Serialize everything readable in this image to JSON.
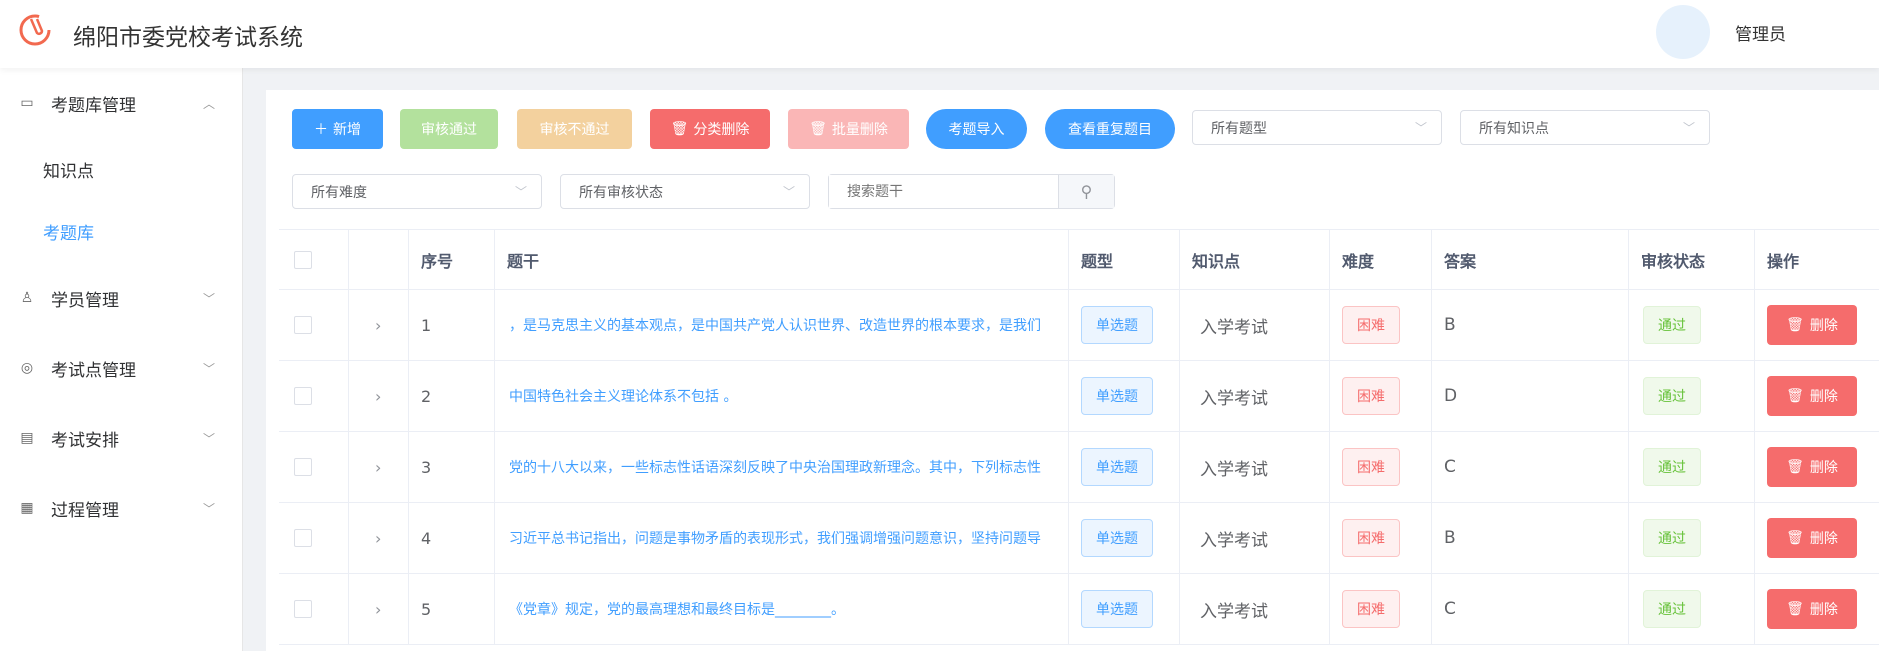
{
  "header": {
    "title": "绵阳市委党校考试系统",
    "user": "管理员"
  },
  "sidebar": {
    "groups": [
      {
        "label": "考题库管理",
        "icon": "folder-icon",
        "expanded": true,
        "children": [
          "知识点",
          "考题库"
        ]
      },
      {
        "label": "学员管理",
        "icon": "user-icon"
      },
      {
        "label": "考试点管理",
        "icon": "location-icon"
      },
      {
        "label": "考试安排",
        "icon": "calendar-icon"
      },
      {
        "label": "过程管理",
        "icon": "grid-icon"
      }
    ],
    "active": "考题库"
  },
  "toolbar": {
    "add": "新增",
    "approve": "审核通过",
    "reject": "审核不通过",
    "delete_category": "分类删除",
    "batch_delete": "批量删除",
    "import": "考题导入",
    "duplicates": "查看重复题目",
    "type_select": "所有题型",
    "knowledge_select": "所有知识点",
    "difficulty_select": "所有难度",
    "status_select": "所有审核状态",
    "search_placeholder": "搜索题干"
  },
  "table": {
    "headers": [
      "序号",
      "题干",
      "题型",
      "知识点",
      "难度",
      "答案",
      "审核状态",
      "操作"
    ],
    "rows": [
      {
        "no": "1",
        "stem": "，是马克思主义的基本观点，是中国共产党人认识世界、改造世界的根本要求，是我们",
        "type": "单选题",
        "knowledge": "入学考试",
        "difficulty": "困难",
        "answer": "B",
        "status": "通过",
        "action": "删除"
      },
      {
        "no": "2",
        "stem": "中国特色社会主义理论体系不包括 。",
        "type": "单选题",
        "knowledge": "入学考试",
        "difficulty": "困难",
        "answer": "D",
        "status": "通过",
        "action": "删除"
      },
      {
        "no": "3",
        "stem": "党的十八大以来，一些标志性话语深刻反映了中央治国理政新理念。其中，下列标志性",
        "type": "单选题",
        "knowledge": "入学考试",
        "difficulty": "困难",
        "answer": "C",
        "status": "通过",
        "action": "删除"
      },
      {
        "no": "4",
        "stem": "习近平总书记指出，问题是事物矛盾的表现形式，我们强调增强问题意识，坚持问题导",
        "type": "单选题",
        "knowledge": "入学考试",
        "difficulty": "困难",
        "answer": "B",
        "status": "通过",
        "action": "删除"
      },
      {
        "no": "5",
        "stem": "《党章》规定，党的最高理想和最终目标是________。",
        "type": "单选题",
        "knowledge": "入学考试",
        "difficulty": "困难",
        "answer": "C",
        "status": "通过",
        "action": "删除"
      }
    ]
  }
}
